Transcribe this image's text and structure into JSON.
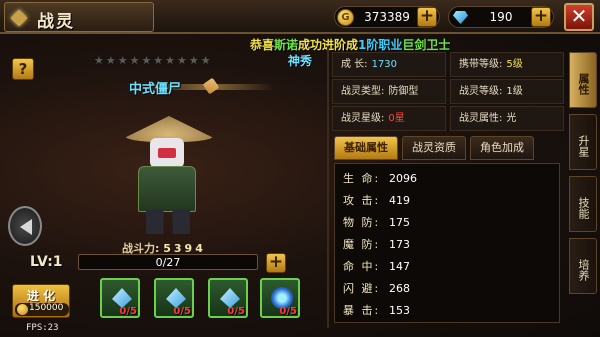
{
  "header": {
    "title": "战灵",
    "gold": "373389",
    "gems": "190",
    "close_symbol": "✕"
  },
  "announcement": {
    "part1": "恭喜",
    "player": "斯诺",
    "part2": "成功进阶成",
    "rank": "1阶职业",
    "item": "巨剑卫士",
    "line2": "神秀"
  },
  "spirit": {
    "name": "中式僵尸",
    "stars_display": "★★★★★★★★★★",
    "power_label": "战斗力:",
    "power_value": "5394",
    "level_label": "LV:1",
    "exp_text": "0/27",
    "exp_fraction": 0,
    "evolve_label": "进 化",
    "evolve_cost": "150000"
  },
  "materials": [
    {
      "icon": "crystal-gem",
      "count": "0/5"
    },
    {
      "icon": "crystal-gem",
      "count": "0/5"
    },
    {
      "icon": "crystal-gem",
      "count": "0/5"
    },
    {
      "icon": "blue-orb",
      "count": "0/5"
    }
  ],
  "info": [
    {
      "label": "成 长:",
      "value": "1730",
      "color": "#6ee0ff"
    },
    {
      "label": "携带等级:",
      "value": "5级",
      "color": "#f2e24a"
    },
    {
      "label": "战灵类型:",
      "value": "防御型",
      "color": "#e8dcc0"
    },
    {
      "label": "战灵等级:",
      "value": "1级",
      "color": "#e8dcc0"
    },
    {
      "label": "战灵星级:",
      "value": "0星",
      "color": "#ff4a3a"
    },
    {
      "label": "战灵属性:",
      "value": "光",
      "color": "#e8dcc0"
    }
  ],
  "tabs": [
    "基础属性",
    "战灵资质",
    "角色加成"
  ],
  "stats": [
    {
      "name": "生 命:",
      "value": "2096"
    },
    {
      "name": "攻 击:",
      "value": "419"
    },
    {
      "name": "物 防:",
      "value": "175"
    },
    {
      "name": "魔 防:",
      "value": "173"
    },
    {
      "name": "命 中:",
      "value": "147"
    },
    {
      "name": "闪 避:",
      "value": "268"
    },
    {
      "name": "暴 击:",
      "value": "153"
    }
  ],
  "side_tabs": [
    "属性",
    "升星",
    "技能",
    "培养"
  ],
  "fps": "FPS:23"
}
